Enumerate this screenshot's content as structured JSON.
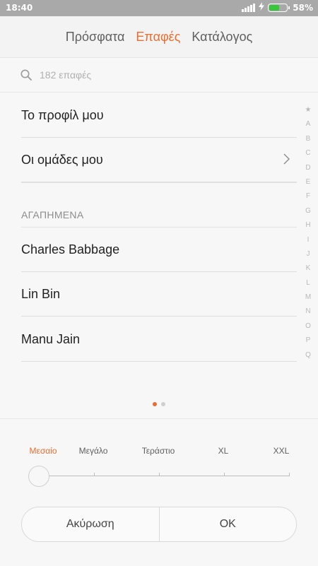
{
  "status_bar": {
    "time": "18:40",
    "battery_pct": "58%",
    "battery_level": 0.58,
    "battery_color": "#35c83b"
  },
  "tabs": [
    {
      "label": "Πρόσφατα",
      "active": false
    },
    {
      "label": "Επαφές",
      "active": true
    },
    {
      "label": "Κατάλογος",
      "active": false
    }
  ],
  "search": {
    "placeholder": "182 επαφές"
  },
  "menu": {
    "my_profile": "Το προφίλ μου",
    "my_groups": "Οι ομάδες μου"
  },
  "favorites": {
    "header": "ΑΓΑΠΗΜΕΝΑ",
    "contacts": [
      "Charles Babbage",
      "Lin Bin",
      "Manu Jain"
    ]
  },
  "alphabet_index": [
    "★",
    "A",
    "B",
    "C",
    "D",
    "E",
    "F",
    "G",
    "H",
    "I",
    "J",
    "K",
    "L",
    "M",
    "N",
    "O",
    "P",
    "Q"
  ],
  "pager": {
    "pages": 2,
    "current": 1
  },
  "font_size_sheet": {
    "sizes": [
      "Μεσαίο",
      "Μεγάλο",
      "Τεράστιο",
      "XL",
      "XXL"
    ],
    "selected_index": 0,
    "cancel_label": "Ακύρωση",
    "ok_label": "OK"
  },
  "colors": {
    "accent": "#e96d2f"
  }
}
